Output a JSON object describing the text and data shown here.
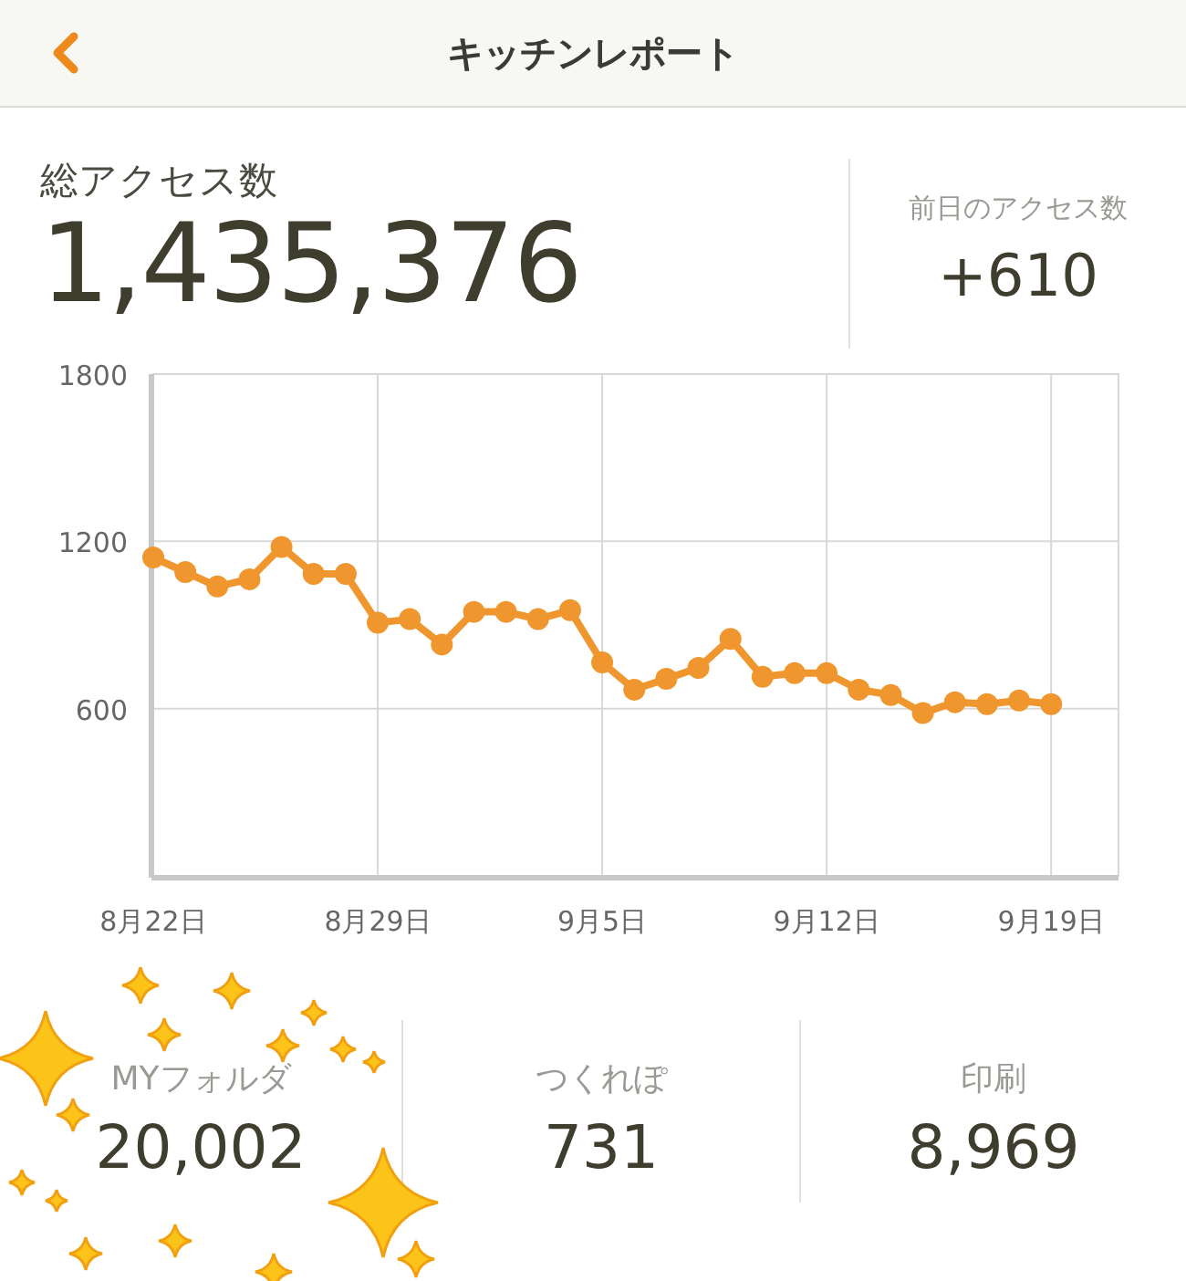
{
  "header": {
    "title": "キッチンレポート"
  },
  "summary": {
    "total_label": "総アクセス数",
    "total_value": "1,435,376",
    "previous_day_label": "前日のアクセス数",
    "previous_day_value": "+610"
  },
  "chart": {
    "chart_data": {
      "type": "line",
      "categories": [
        "8月22日",
        null,
        null,
        null,
        null,
        null,
        null,
        "8月29日",
        null,
        null,
        null,
        null,
        null,
        null,
        "9月5日",
        null,
        null,
        null,
        null,
        null,
        null,
        "9月12日",
        null,
        null,
        null,
        null,
        null,
        null,
        "9月19日"
      ],
      "series": [
        {
          "color": "#f0962e",
          "marker": "circle",
          "values": [
            1142,
            1090,
            1038,
            1064,
            1180,
            1083,
            1083,
            908,
            921,
            830,
            947,
            947,
            921,
            953,
            766,
            668,
            707,
            746,
            850,
            714,
            727,
            727,
            668,
            649,
            584,
            623,
            616,
            629,
            616
          ]
        }
      ],
      "grid": true,
      "ylim": [
        0,
        1800
      ],
      "yticks": [
        600,
        1200,
        1800
      ]
    }
  },
  "stats": [
    {
      "label": "MYフォルダ",
      "value": "20,002"
    },
    {
      "label": "つくれぽ",
      "value": "731"
    },
    {
      "label": "印刷",
      "value": "8,969"
    }
  ]
}
